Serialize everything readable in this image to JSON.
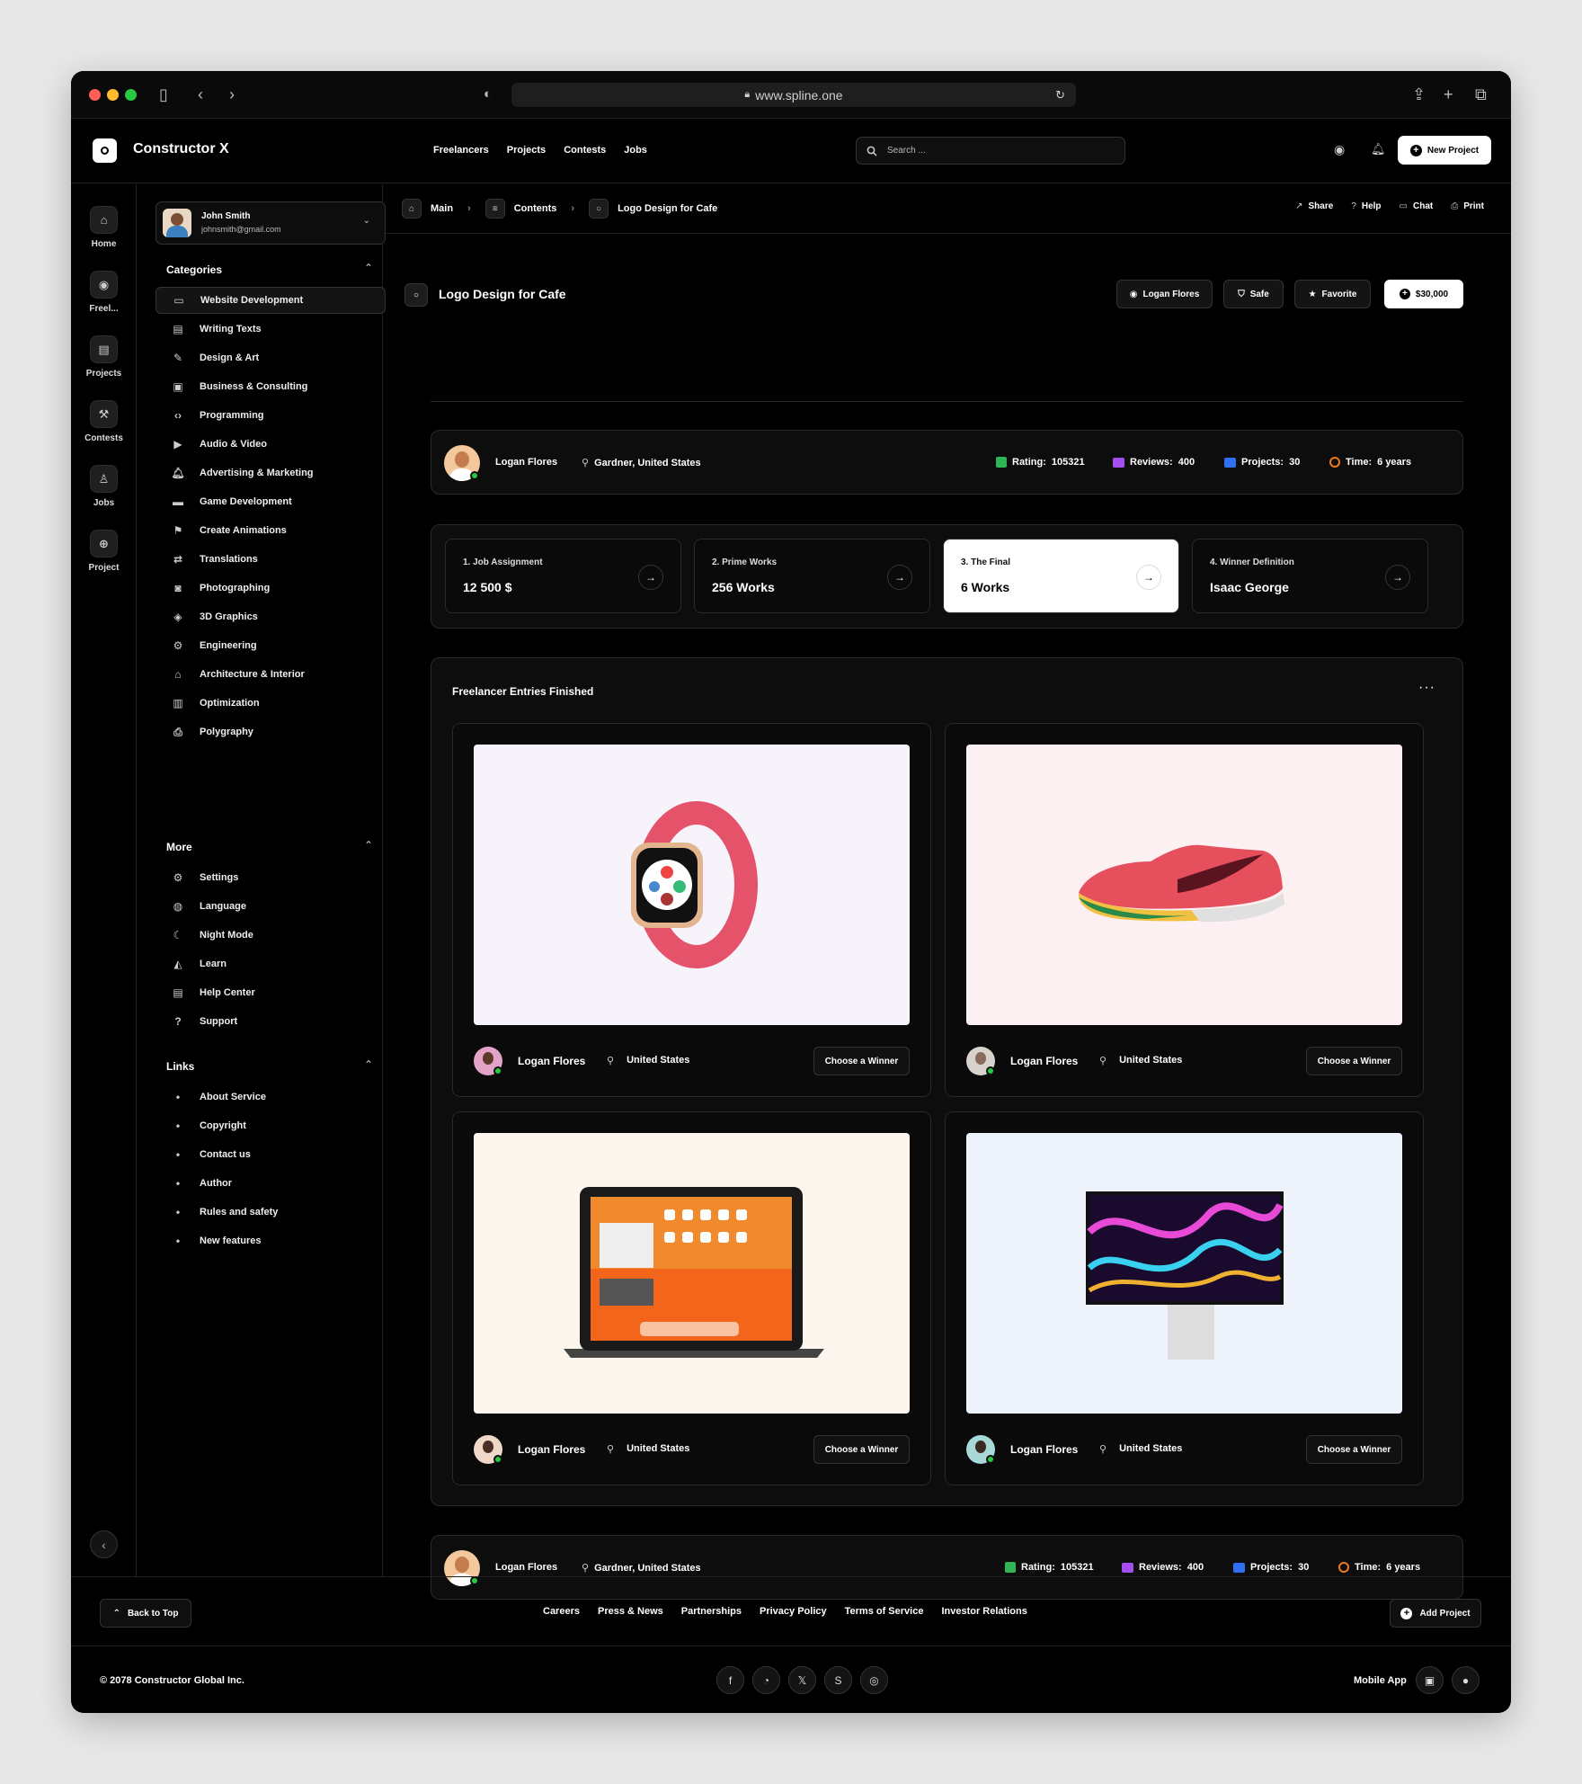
{
  "browser": {
    "url": "www.spline.one"
  },
  "app": {
    "brand": "Constructor X",
    "nav": [
      "Freelancers",
      "Projects",
      "Contests",
      "Jobs"
    ],
    "search_placeholder": "Search ...",
    "new_project": "New Project"
  },
  "rail": [
    "Home",
    "Freel...",
    "Projects",
    "Contests",
    "Jobs",
    "Project"
  ],
  "user": {
    "name": "John Smith",
    "email": "johnsmith@gmail.com"
  },
  "sidebar": {
    "categories_title": "Categories",
    "categories": [
      {
        "label": "Website Development",
        "icon": "monitor-icon"
      },
      {
        "label": "Writing Texts",
        "icon": "document-icon"
      },
      {
        "label": "Design & Art",
        "icon": "brush-icon"
      },
      {
        "label": "Business & Consulting",
        "icon": "briefcase-icon"
      },
      {
        "label": "Programming",
        "icon": "code-icon"
      },
      {
        "label": "Audio & Video",
        "icon": "video-icon"
      },
      {
        "label": "Advertising & Marketing",
        "icon": "bell-icon"
      },
      {
        "label": "Game Development",
        "icon": "gamepad-icon"
      },
      {
        "label": "Create Animations",
        "icon": "running-icon"
      },
      {
        "label": "Translations",
        "icon": "translate-icon"
      },
      {
        "label": "Photographing",
        "icon": "camera-icon"
      },
      {
        "label": "3D Graphics",
        "icon": "cube-icon"
      },
      {
        "label": "Engineering",
        "icon": "gear-icon"
      },
      {
        "label": "Architecture & Interior",
        "icon": "home-icon"
      },
      {
        "label": "Optimization",
        "icon": "chart-icon"
      },
      {
        "label": "Polygraphy",
        "icon": "printer-icon"
      }
    ],
    "more_title": "More",
    "more": [
      {
        "label": "Settings",
        "icon": "gear-icon"
      },
      {
        "label": "Language",
        "icon": "globe-icon"
      },
      {
        "label": "Night Mode",
        "icon": "moon-icon"
      },
      {
        "label": "Learn",
        "icon": "graduation-icon"
      },
      {
        "label": "Help Center",
        "icon": "document-icon"
      },
      {
        "label": "Support",
        "icon": "help-icon"
      }
    ],
    "links_title": "Links",
    "links": [
      "About Service",
      "Copyright",
      "Contact us",
      "Author",
      "Rules and safety",
      "New features"
    ]
  },
  "breadcrumb": [
    "Main",
    "Contents",
    "Logo Design for Cafe"
  ],
  "actions": [
    "Share",
    "Help",
    "Chat",
    "Print"
  ],
  "project": {
    "title": "Logo Design for Cafe",
    "owner": "Logan Flores",
    "safe": "Safe",
    "favorite": "Favorite",
    "price": "$30,000"
  },
  "profile": {
    "name": "Logan Flores",
    "location": "Gardner, United States",
    "rating_label": "Rating:",
    "rating": "105321",
    "reviews_label": "Reviews:",
    "reviews": "400",
    "projects_label": "Projects:",
    "projects": "30",
    "time_label": "Time:",
    "time": "6 years"
  },
  "steps": [
    {
      "label": "1. Job Assignment",
      "value": "12 500 $"
    },
    {
      "label": "2. Prime Works",
      "value": "256 Works"
    },
    {
      "label": "3. The Final",
      "value": "6 Works"
    },
    {
      "label": "4. Winner Definition",
      "value": "Isaac George"
    }
  ],
  "entries": {
    "title": "Freelancer Entries Finished",
    "items": [
      {
        "name": "Logan Flores",
        "location": "United States",
        "button": "Choose a Winner",
        "bg": "#f7f3fb"
      },
      {
        "name": "Logan Flores",
        "location": "United States",
        "button": "Choose a Winner",
        "bg": "#fcf0f3"
      },
      {
        "name": "Logan Flores",
        "location": "United States",
        "button": "Choose a Winner",
        "bg": "#fdf6ee"
      },
      {
        "name": "Logan Flores",
        "location": "United States",
        "button": "Choose a Winner",
        "bg": "#eef3fb"
      }
    ]
  },
  "footer": {
    "back_to_top": "Back to Top",
    "links": [
      "Careers",
      "Press & News",
      "Partnerships",
      "Privacy Policy",
      "Terms of Service",
      "Investor Relations"
    ],
    "add_project": "Add Project",
    "copyright": "© 2078 Constructor Global Inc.",
    "mobile_app": "Mobile App"
  },
  "colors": {
    "rating": "#2fb457",
    "reviews": "#a44ef0",
    "projects": "#2f6ff0",
    "time": "#f07a1a",
    "online": "#28c840"
  }
}
